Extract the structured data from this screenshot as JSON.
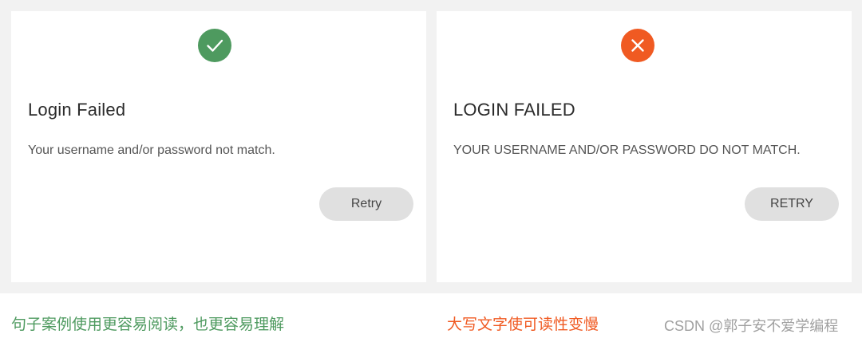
{
  "cards": [
    {
      "status_icon": "check-icon",
      "status_color": "#4e9a5f",
      "title": "Login Failed",
      "message": "Your username and/or password not match.",
      "button_label": "Retry"
    },
    {
      "status_icon": "close-icon",
      "status_color": "#f05a22",
      "title": "LOGIN FAILED",
      "message": "YOUR USERNAME AND/OR PASSWORD DO NOT MATCH.",
      "button_label": "RETRY"
    }
  ],
  "captions": {
    "good": "句子案例使用更容易阅读，也更容易理解",
    "bad": "大写文字使可读性变慢",
    "good_color": "#4e9a5f",
    "bad_color": "#f05a22"
  },
  "watermark": "CSDN @郭子安不爱学编程"
}
